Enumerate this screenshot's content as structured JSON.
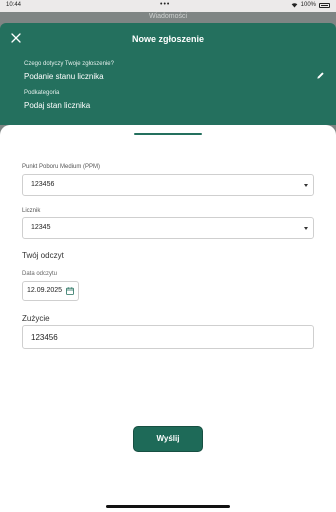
{
  "status_bar": {
    "time": "10:44",
    "dots": "•••",
    "battery": "100%"
  },
  "background": {
    "title": "Wiadomości"
  },
  "header": {
    "title": "Nowe zgłoszenie",
    "question_label": "Czego dotyczy Twoje zgłoszenie?",
    "question_value": "Podanie stanu licznika",
    "subcategory_label": "Podkategoria",
    "subcategory_value": "Podaj stan licznika",
    "accent_color": "#24705e"
  },
  "form": {
    "ppm_label": "Punkt Poboru Medium (PPM)",
    "ppm_value": "123456",
    "meter_label": "Licznik",
    "meter_value": "12345",
    "reading_section_title": "Twój odczyt",
    "date_label": "Data odczytu",
    "date_value": "12.09.2025",
    "usage_label": "Zużycie",
    "usage_value": "123456",
    "submit_label": "Wyślij"
  }
}
